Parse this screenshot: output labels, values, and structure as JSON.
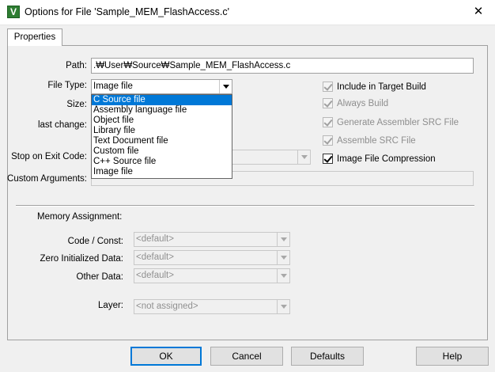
{
  "window": {
    "title": "Options for File 'Sample_MEM_FlashAccess.c'",
    "close_glyph": "✕"
  },
  "tab": {
    "label": "Properties"
  },
  "fields": {
    "path_label": "Path:",
    "path_value": ".₩User₩Source₩Sample_MEM_FlashAccess.c",
    "file_type_label": "File Type:",
    "file_type_value": "Image file",
    "size_label": "Size:",
    "last_change_label": "last change:",
    "stop_on_exit_label": "Stop on Exit Code:",
    "custom_args_label": "Custom Arguments:"
  },
  "file_type_options": [
    "C Source file",
    "Assembly language file",
    "Object file",
    "Library file",
    "Text Document file",
    "Custom file",
    "C++ Source file",
    "Image file"
  ],
  "checkboxes": {
    "include_label": "Include in Target Build",
    "always_build_label": "Always Build",
    "generate_src_label": "Generate Assembler SRC File",
    "assemble_src_label": "Assemble SRC File",
    "image_compression_label": "Image File Compression"
  },
  "memory": {
    "heading": "Memory Assignment:",
    "code_label": "Code / Const:",
    "code_value": "<default>",
    "zero_label": "Zero Initialized Data:",
    "zero_value": "<default>",
    "other_label": "Other Data:",
    "other_value": "<default>",
    "layer_label": "Layer:",
    "layer_value": "<not assigned>"
  },
  "buttons": {
    "ok": "OK",
    "cancel": "Cancel",
    "defaults": "Defaults",
    "help": "Help"
  },
  "icons": {
    "app": "uvision-app-icon",
    "close": "close-icon",
    "dropdown": "chevron-down-icon",
    "check": "checkmark-icon"
  },
  "colors": {
    "selection": "#0078d7",
    "dialog_bg": "#f0f0f0",
    "disabled_text": "#8e8e8e"
  }
}
